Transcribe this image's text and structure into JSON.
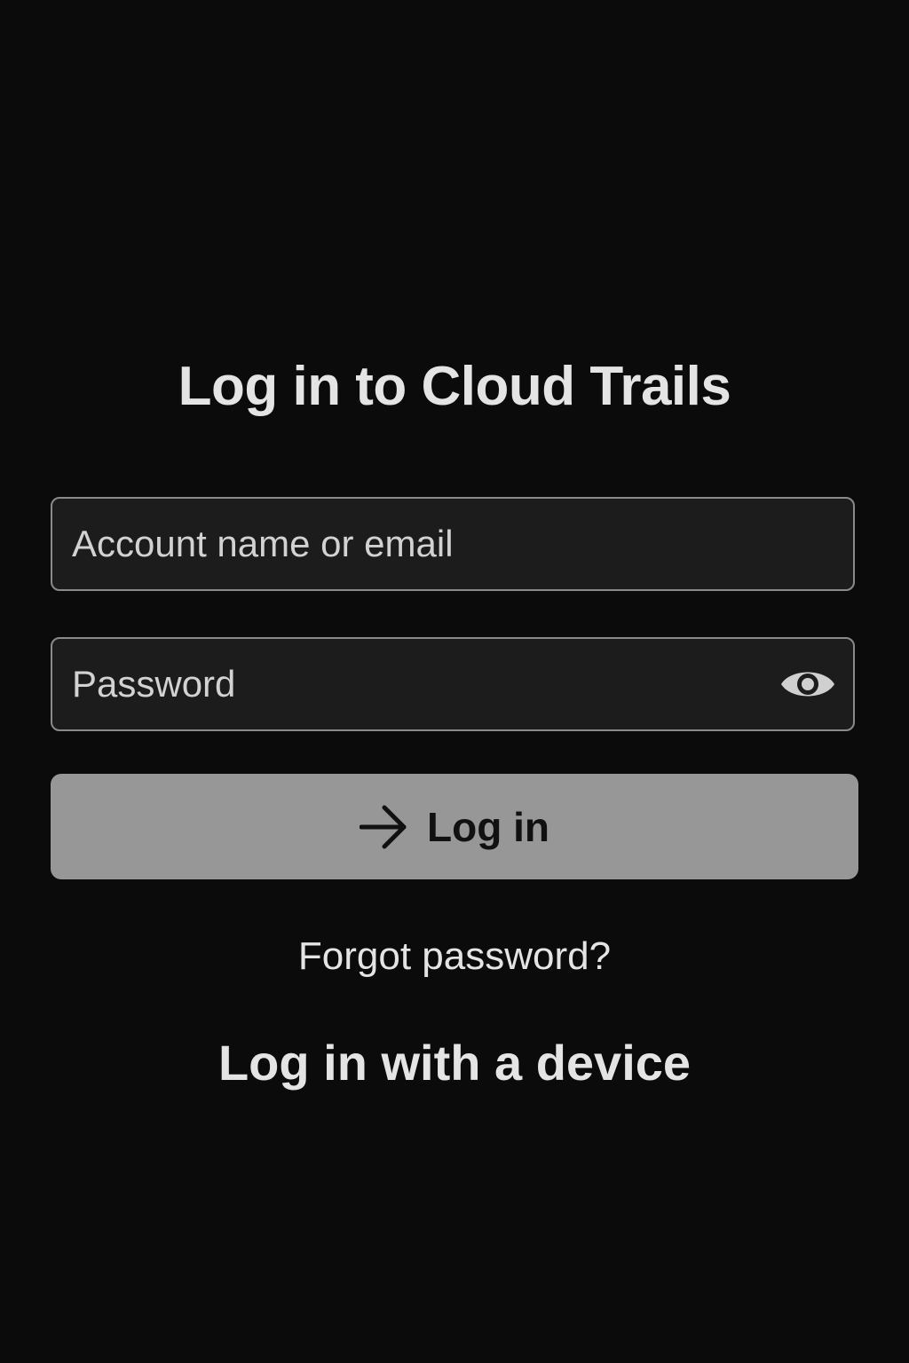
{
  "page": {
    "title": "Log in to Cloud Trails"
  },
  "form": {
    "account": {
      "value": "",
      "placeholder": "Account name or email"
    },
    "password": {
      "value": "",
      "placeholder": "Password",
      "toggle_icon": "eye-icon"
    },
    "submit": {
      "label": "Log in",
      "icon": "arrow-right-icon"
    }
  },
  "links": {
    "forgot_password": "Forgot password?",
    "device_login": "Log in with a device"
  },
  "colors": {
    "background": "#0b0b0b",
    "field_background": "#1c1c1c",
    "field_border": "#8a8a8a",
    "button_background": "#979797",
    "button_text": "#111111",
    "text": "#e4e4e4"
  }
}
